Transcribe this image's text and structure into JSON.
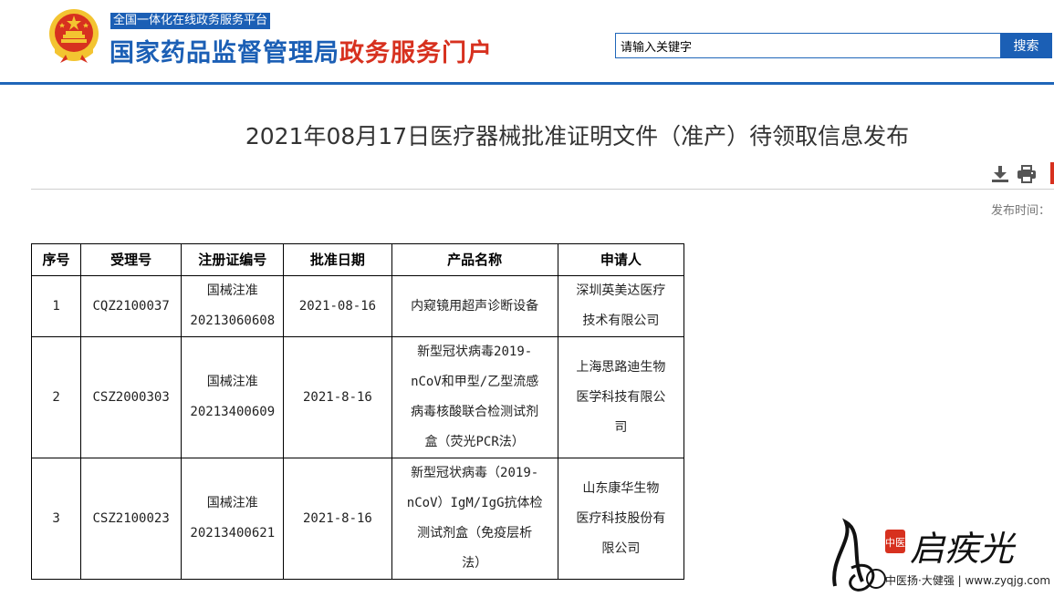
{
  "header": {
    "platform_tag": "全国一体化在线政务服务平台",
    "title_main": "国家药品监督管理局",
    "title_sub": "政务服务门户",
    "search_placeholder": "请输入关键字",
    "search_value": "请输入关键字",
    "search_button": "搜索",
    "brand_blue": "#1b5fb5",
    "accent_red": "#d7311f"
  },
  "article": {
    "title": "2021年08月17日医疗器械批准证明文件（准产）待领取信息发布",
    "publish_label": "发布时间：",
    "tools": [
      "download-icon",
      "print-icon"
    ]
  },
  "table": {
    "headers": [
      "序号",
      "受理号",
      "注册证编号",
      "批准日期",
      "产品名称",
      "申请人"
    ],
    "rows": [
      {
        "no": "1",
        "accept_no": "CQZ2100037",
        "reg_no_1": "国械注准",
        "reg_no_2": "20213060608",
        "date": "2021-08-16",
        "product": [
          "内窥镜用超声诊断设备"
        ],
        "applicant": [
          "深圳英美达医疗",
          "技术有限公司"
        ]
      },
      {
        "no": "2",
        "accept_no": "CSZ2000303",
        "reg_no_1": "国械注准",
        "reg_no_2": "20213400609",
        "date": "2021-8-16",
        "product": [
          "新型冠状病毒2019-",
          "nCoV和甲型/乙型流感",
          "病毒核酸联合检测试剂",
          "盒（荧光PCR法）"
        ],
        "applicant": [
          "上海思路迪生物",
          "医学科技有限公",
          "司"
        ]
      },
      {
        "no": "3",
        "accept_no": "CSZ2100023",
        "reg_no_1": "国械注准",
        "reg_no_2": "20213400621",
        "date": "2021-8-16",
        "product": [
          "新型冠状病毒（2019-",
          "nCoV）IgM/IgG抗体检",
          "测试剂盒（免疫层析",
          "法）"
        ],
        "applicant": [
          "山东康华生物",
          "医疗科技股份有",
          "限公司"
        ]
      }
    ]
  },
  "watermark": {
    "seal_text": "中医",
    "brand": "启疾光",
    "site": "中医扬·大健强 | www.zyqjg.com"
  }
}
